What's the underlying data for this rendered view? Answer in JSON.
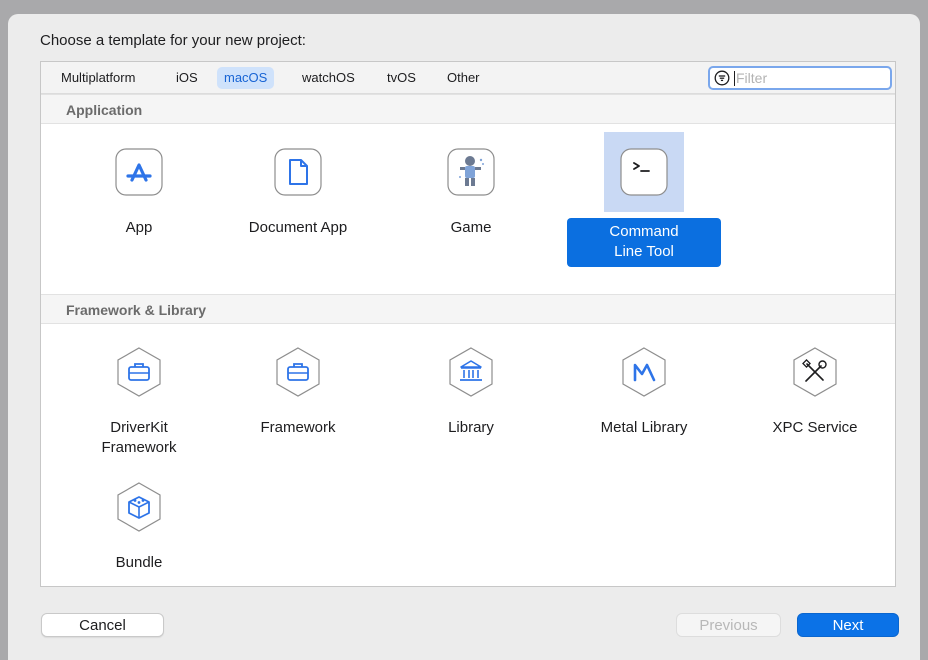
{
  "dialog": {
    "prompt": "Choose a template for your new project:"
  },
  "tabs": [
    {
      "label": "Multiplatform",
      "selected": false
    },
    {
      "label": "iOS",
      "selected": false
    },
    {
      "label": "macOS",
      "selected": true
    },
    {
      "label": "watchOS",
      "selected": false
    },
    {
      "label": "tvOS",
      "selected": false
    },
    {
      "label": "Other",
      "selected": false
    }
  ],
  "filter": {
    "placeholder": "Filter",
    "value": "",
    "icon": "filter-icon"
  },
  "sections": [
    {
      "title": "Application",
      "items": [
        {
          "label": "App",
          "icon": "app-store-icon",
          "selected": false
        },
        {
          "label": "Document App",
          "icon": "document-icon",
          "selected": false
        },
        {
          "label": "Game",
          "icon": "game-icon",
          "selected": false
        },
        {
          "label": "Command\nLine Tool",
          "icon": "terminal-icon",
          "selected": true
        }
      ]
    },
    {
      "title": "Framework & Library",
      "items": [
        {
          "label": "DriverKit\nFramework",
          "icon": "toolbox-icon"
        },
        {
          "label": "Framework",
          "icon": "toolbox-icon"
        },
        {
          "label": "Library",
          "icon": "library-icon"
        },
        {
          "label": "Metal Library",
          "icon": "metal-icon"
        },
        {
          "label": "XPC Service",
          "icon": "tools-icon"
        },
        {
          "label": "Bundle",
          "icon": "cube-icon"
        }
      ]
    }
  ],
  "buttons": {
    "cancel": "Cancel",
    "previous": "Previous",
    "next": "Next"
  },
  "colors": {
    "accent": "#0b6fe0",
    "tab_selected_bg": "#cfe2fb",
    "icon_selected_bg": "#c9d9f4"
  }
}
